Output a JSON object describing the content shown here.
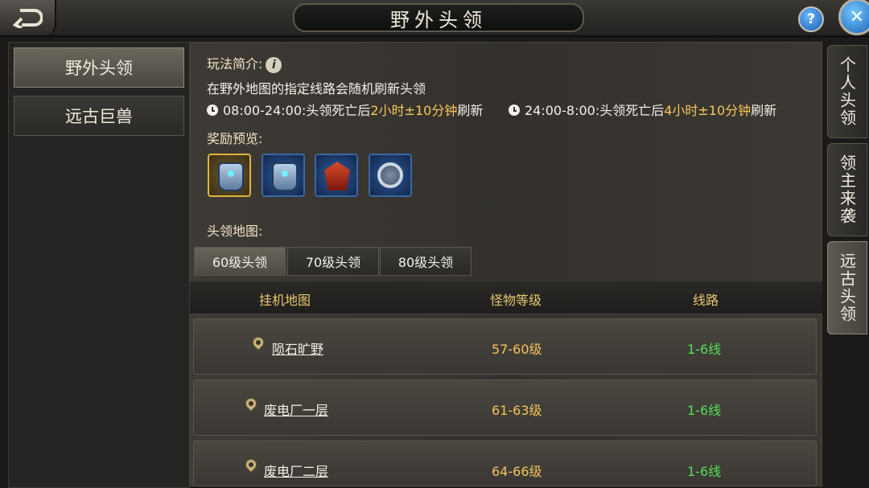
{
  "header": {
    "title": "野外头领"
  },
  "left_tabs": [
    {
      "label": "野外头领",
      "active": true
    },
    {
      "label": "远古巨兽",
      "active": false
    }
  ],
  "intro": {
    "label": "玩法简介:",
    "description": "在野外地图的指定线路会随机刷新头领",
    "schedule": [
      {
        "pre": "08:00-24:00:头领死亡后",
        "highlight": "2小时±10分钟",
        "post": "刷新"
      },
      {
        "pre": "24:00-8:00:头领死亡后",
        "highlight": "4小时±10分钟",
        "post": "刷新"
      }
    ]
  },
  "rewards": {
    "label": "奖励预览:",
    "items": [
      {
        "icon": "armor-gold-icon"
      },
      {
        "icon": "armor-blue-icon"
      },
      {
        "icon": "helmet-icon"
      },
      {
        "icon": "ring-icon"
      }
    ]
  },
  "boss_map": {
    "label": "头领地图:",
    "level_tabs": [
      {
        "label": "60级头领",
        "active": true
      },
      {
        "label": "70级头领",
        "active": false
      },
      {
        "label": "80级头领",
        "active": false
      }
    ]
  },
  "table": {
    "headers": [
      "挂机地图",
      "怪物等级",
      "线路"
    ],
    "rows": [
      {
        "map": "陨石旷野",
        "level": "57-60级",
        "line": "1-6线"
      },
      {
        "map": "废电厂一层",
        "level": "61-63级",
        "line": "1-6线"
      },
      {
        "map": "废电厂二层",
        "level": "64-66级",
        "line": "1-6线"
      }
    ]
  },
  "right_tabs": [
    {
      "label": "个人头领",
      "active": false
    },
    {
      "label": "领主来袭",
      "active": false
    },
    {
      "label": "远古头领",
      "active": true
    }
  ],
  "colors": {
    "highlight": "#f7c65a",
    "line_green": "#53e05a",
    "header_gold": "#e8c772"
  }
}
